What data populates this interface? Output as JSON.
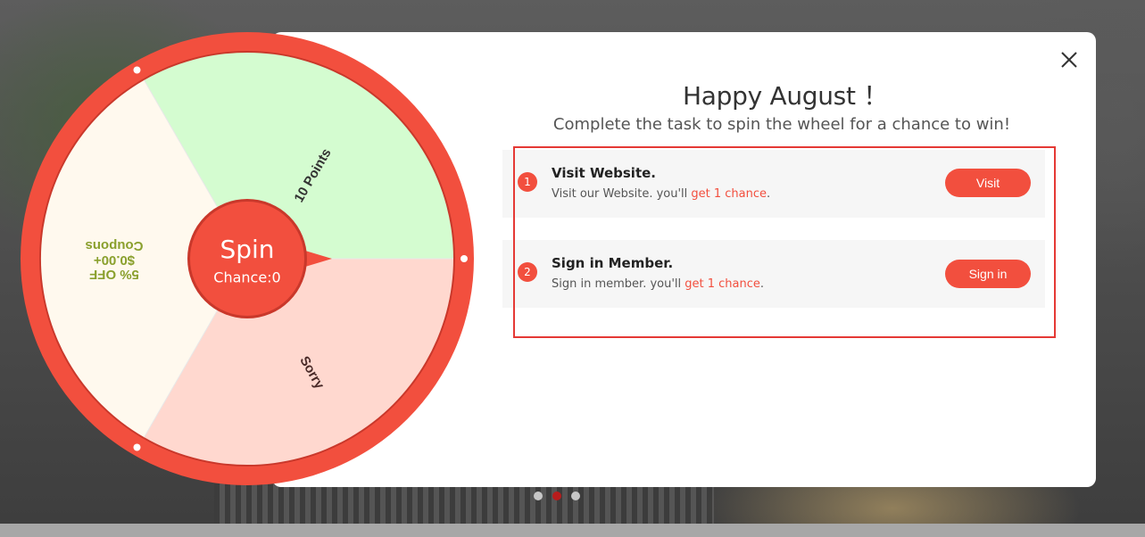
{
  "modal": {
    "title": "Happy August ！",
    "subtitle": "Complete the task to spin the wheel for a chance to win!"
  },
  "tasks": [
    {
      "number": "1",
      "title": "Visit Website.",
      "desc_prefix": "Visit our Website. you'll ",
      "desc_highlight": "get 1 chance",
      "desc_suffix": ".",
      "button": "Visit"
    },
    {
      "number": "2",
      "title": "Sign in Member.",
      "desc_prefix": "Sign in member. you'll ",
      "desc_highlight": "get 1 chance",
      "desc_suffix": ".",
      "button": "Sign in"
    }
  ],
  "wheel": {
    "spin_label": "Spin",
    "chance_label": "Chance:0",
    "segments": [
      {
        "label": "10 Points",
        "color": "#d4fcd0"
      },
      {
        "label": "Sorry",
        "color": "#ffd8cf"
      },
      {
        "label_lines": [
          "5% OFF",
          "$0.00+",
          "Coupons"
        ],
        "color": "#fff9ee"
      }
    ]
  },
  "carousel": {
    "active_index": 1,
    "count": 3
  },
  "colors": {
    "accent": "#f24f3e",
    "wheel_rim": "#f24f3e",
    "highlight_border": "#e53935"
  },
  "icons": {
    "close": "close-icon"
  }
}
